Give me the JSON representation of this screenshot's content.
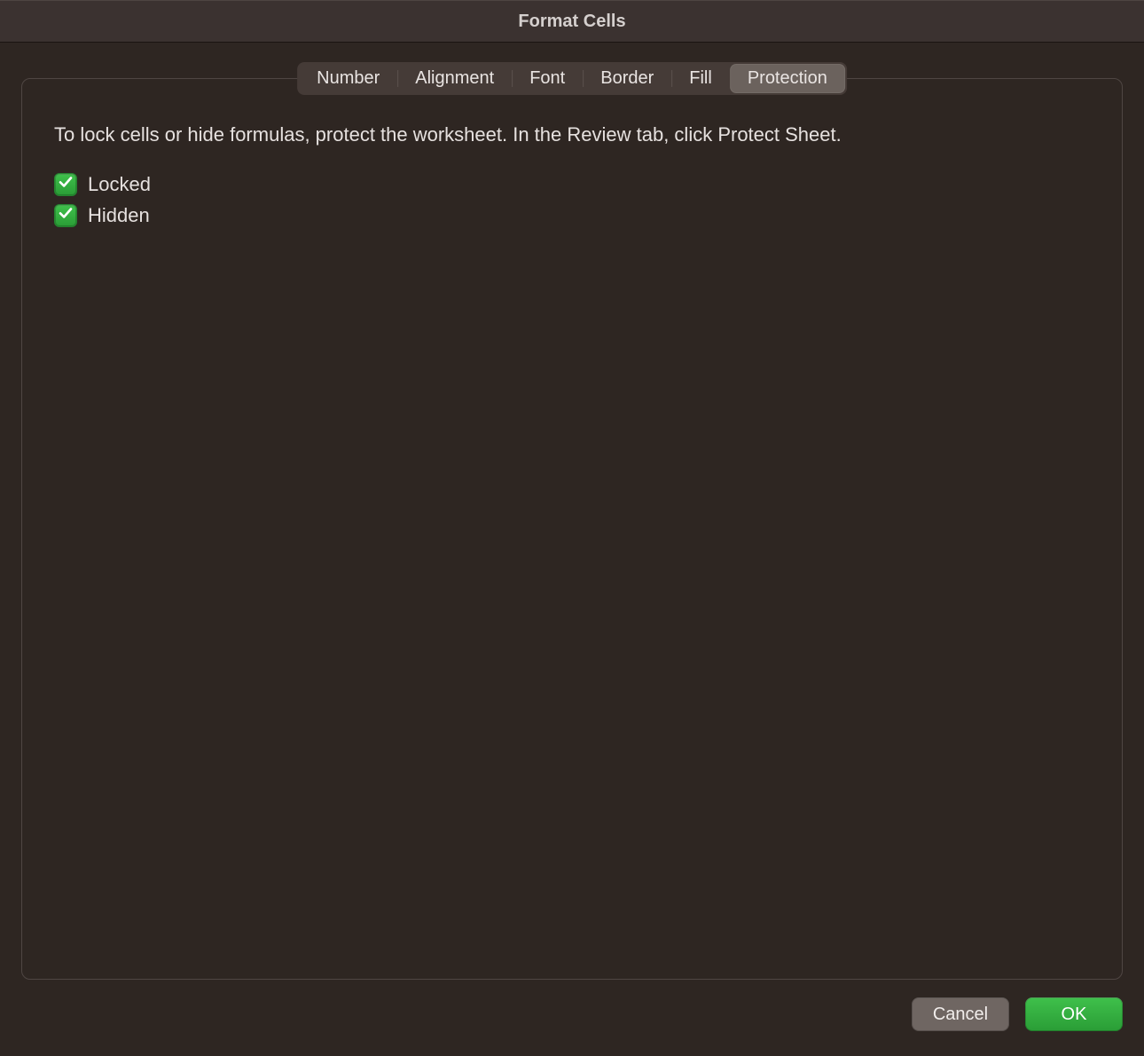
{
  "dialog": {
    "title": "Format Cells"
  },
  "tabs": {
    "number": "Number",
    "alignment": "Alignment",
    "font": "Font",
    "border": "Border",
    "fill": "Fill",
    "protection": "Protection",
    "active": "protection"
  },
  "pane": {
    "description": "To lock cells or hide formulas, protect the worksheet. In the Review tab, click Protect Sheet.",
    "locked_label": "Locked",
    "hidden_label": "Hidden",
    "locked_checked": true,
    "hidden_checked": true
  },
  "buttons": {
    "cancel": "Cancel",
    "ok": "OK"
  },
  "colors": {
    "accent_green": "#2a9d36",
    "window_bg": "#2e2622",
    "titlebar_bg": "#3b3230"
  }
}
